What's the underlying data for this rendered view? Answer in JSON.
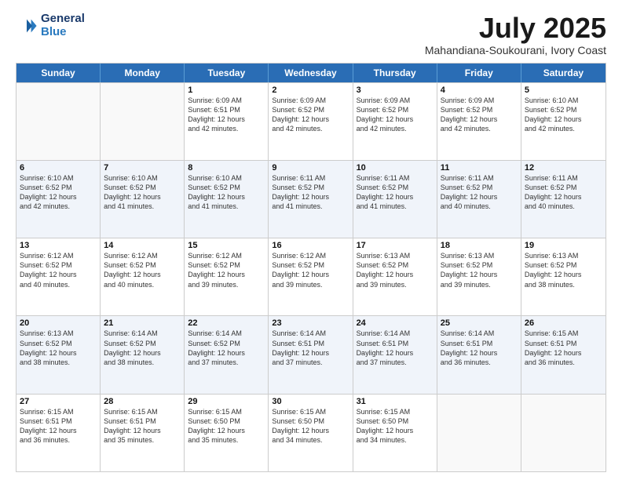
{
  "header": {
    "logo_line1": "General",
    "logo_line2": "Blue",
    "title": "July 2025",
    "subtitle": "Mahandiana-Soukourani, Ivory Coast"
  },
  "days_of_week": [
    "Sunday",
    "Monday",
    "Tuesday",
    "Wednesday",
    "Thursday",
    "Friday",
    "Saturday"
  ],
  "weeks": [
    [
      {
        "day": "",
        "empty": true
      },
      {
        "day": "",
        "empty": true
      },
      {
        "day": "1",
        "lines": [
          "Sunrise: 6:09 AM",
          "Sunset: 6:51 PM",
          "Daylight: 12 hours",
          "and 42 minutes."
        ]
      },
      {
        "day": "2",
        "lines": [
          "Sunrise: 6:09 AM",
          "Sunset: 6:52 PM",
          "Daylight: 12 hours",
          "and 42 minutes."
        ]
      },
      {
        "day": "3",
        "lines": [
          "Sunrise: 6:09 AM",
          "Sunset: 6:52 PM",
          "Daylight: 12 hours",
          "and 42 minutes."
        ]
      },
      {
        "day": "4",
        "lines": [
          "Sunrise: 6:09 AM",
          "Sunset: 6:52 PM",
          "Daylight: 12 hours",
          "and 42 minutes."
        ]
      },
      {
        "day": "5",
        "lines": [
          "Sunrise: 6:10 AM",
          "Sunset: 6:52 PM",
          "Daylight: 12 hours",
          "and 42 minutes."
        ]
      }
    ],
    [
      {
        "day": "6",
        "lines": [
          "Sunrise: 6:10 AM",
          "Sunset: 6:52 PM",
          "Daylight: 12 hours",
          "and 42 minutes."
        ]
      },
      {
        "day": "7",
        "lines": [
          "Sunrise: 6:10 AM",
          "Sunset: 6:52 PM",
          "Daylight: 12 hours",
          "and 41 minutes."
        ]
      },
      {
        "day": "8",
        "lines": [
          "Sunrise: 6:10 AM",
          "Sunset: 6:52 PM",
          "Daylight: 12 hours",
          "and 41 minutes."
        ]
      },
      {
        "day": "9",
        "lines": [
          "Sunrise: 6:11 AM",
          "Sunset: 6:52 PM",
          "Daylight: 12 hours",
          "and 41 minutes."
        ]
      },
      {
        "day": "10",
        "lines": [
          "Sunrise: 6:11 AM",
          "Sunset: 6:52 PM",
          "Daylight: 12 hours",
          "and 41 minutes."
        ]
      },
      {
        "day": "11",
        "lines": [
          "Sunrise: 6:11 AM",
          "Sunset: 6:52 PM",
          "Daylight: 12 hours",
          "and 40 minutes."
        ]
      },
      {
        "day": "12",
        "lines": [
          "Sunrise: 6:11 AM",
          "Sunset: 6:52 PM",
          "Daylight: 12 hours",
          "and 40 minutes."
        ]
      }
    ],
    [
      {
        "day": "13",
        "lines": [
          "Sunrise: 6:12 AM",
          "Sunset: 6:52 PM",
          "Daylight: 12 hours",
          "and 40 minutes."
        ]
      },
      {
        "day": "14",
        "lines": [
          "Sunrise: 6:12 AM",
          "Sunset: 6:52 PM",
          "Daylight: 12 hours",
          "and 40 minutes."
        ]
      },
      {
        "day": "15",
        "lines": [
          "Sunrise: 6:12 AM",
          "Sunset: 6:52 PM",
          "Daylight: 12 hours",
          "and 39 minutes."
        ]
      },
      {
        "day": "16",
        "lines": [
          "Sunrise: 6:12 AM",
          "Sunset: 6:52 PM",
          "Daylight: 12 hours",
          "and 39 minutes."
        ]
      },
      {
        "day": "17",
        "lines": [
          "Sunrise: 6:13 AM",
          "Sunset: 6:52 PM",
          "Daylight: 12 hours",
          "and 39 minutes."
        ]
      },
      {
        "day": "18",
        "lines": [
          "Sunrise: 6:13 AM",
          "Sunset: 6:52 PM",
          "Daylight: 12 hours",
          "and 39 minutes."
        ]
      },
      {
        "day": "19",
        "lines": [
          "Sunrise: 6:13 AM",
          "Sunset: 6:52 PM",
          "Daylight: 12 hours",
          "and 38 minutes."
        ]
      }
    ],
    [
      {
        "day": "20",
        "lines": [
          "Sunrise: 6:13 AM",
          "Sunset: 6:52 PM",
          "Daylight: 12 hours",
          "and 38 minutes."
        ]
      },
      {
        "day": "21",
        "lines": [
          "Sunrise: 6:14 AM",
          "Sunset: 6:52 PM",
          "Daylight: 12 hours",
          "and 38 minutes."
        ]
      },
      {
        "day": "22",
        "lines": [
          "Sunrise: 6:14 AM",
          "Sunset: 6:52 PM",
          "Daylight: 12 hours",
          "and 37 minutes."
        ]
      },
      {
        "day": "23",
        "lines": [
          "Sunrise: 6:14 AM",
          "Sunset: 6:51 PM",
          "Daylight: 12 hours",
          "and 37 minutes."
        ]
      },
      {
        "day": "24",
        "lines": [
          "Sunrise: 6:14 AM",
          "Sunset: 6:51 PM",
          "Daylight: 12 hours",
          "and 37 minutes."
        ]
      },
      {
        "day": "25",
        "lines": [
          "Sunrise: 6:14 AM",
          "Sunset: 6:51 PM",
          "Daylight: 12 hours",
          "and 36 minutes."
        ]
      },
      {
        "day": "26",
        "lines": [
          "Sunrise: 6:15 AM",
          "Sunset: 6:51 PM",
          "Daylight: 12 hours",
          "and 36 minutes."
        ]
      }
    ],
    [
      {
        "day": "27",
        "lines": [
          "Sunrise: 6:15 AM",
          "Sunset: 6:51 PM",
          "Daylight: 12 hours",
          "and 36 minutes."
        ]
      },
      {
        "day": "28",
        "lines": [
          "Sunrise: 6:15 AM",
          "Sunset: 6:51 PM",
          "Daylight: 12 hours",
          "and 35 minutes."
        ]
      },
      {
        "day": "29",
        "lines": [
          "Sunrise: 6:15 AM",
          "Sunset: 6:50 PM",
          "Daylight: 12 hours",
          "and 35 minutes."
        ]
      },
      {
        "day": "30",
        "lines": [
          "Sunrise: 6:15 AM",
          "Sunset: 6:50 PM",
          "Daylight: 12 hours",
          "and 34 minutes."
        ]
      },
      {
        "day": "31",
        "lines": [
          "Sunrise: 6:15 AM",
          "Sunset: 6:50 PM",
          "Daylight: 12 hours",
          "and 34 minutes."
        ]
      },
      {
        "day": "",
        "empty": true
      },
      {
        "day": "",
        "empty": true
      }
    ]
  ]
}
